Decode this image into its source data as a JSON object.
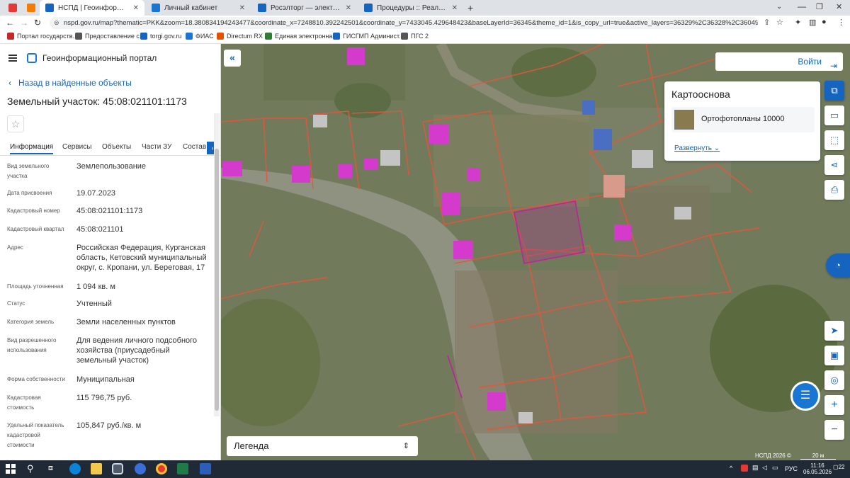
{
  "browser": {
    "tabs": [
      {
        "label": "",
        "color": "#e53935"
      },
      {
        "label": "",
        "color": "#f57c00"
      },
      {
        "label": "НСПД | Геоинформационный п",
        "color": "#1565c0",
        "active": true
      },
      {
        "label": "Личный кабинет",
        "color": "#1976d2"
      },
      {
        "label": "Росэлторг — электронная торго",
        "color": "#1565c0"
      },
      {
        "label": "Процедуры :: Реализация госи",
        "color": "#1565c0"
      }
    ],
    "new_tab": "+",
    "url": "nspd.gov.ru/map?thematic=PKK&zoom=18.380834194243477&coordinate_x=7248810.392242501&coordinate_y=7433045.429648423&baseLayerId=36345&theme_id=1&is_copy_url=true&active_layers=36329%2C36328%2C36049%2C37298%2C3729...",
    "bookmarks": [
      {
        "label": "Портал государств...",
        "color": "#c62828"
      },
      {
        "label": "Предоставление с...",
        "color": "#555"
      },
      {
        "label": "torgi.gov.ru",
        "color": "#1565c0"
      },
      {
        "label": "ФИАС",
        "color": "#1976d2"
      },
      {
        "label": "Directum RX",
        "color": "#e65100"
      },
      {
        "label": "Единая электронна...",
        "color": "#2e7d32"
      },
      {
        "label": "ГИСГМП Админист...",
        "color": "#1565c0"
      },
      {
        "label": "ПГС 2",
        "color": "#555"
      }
    ]
  },
  "header": {
    "portal_title": "Геоинформационный портал"
  },
  "panel": {
    "back_label": "Назад в найденные объекты",
    "title": "Земельный участок: 45:08:021101:1173",
    "tabs": [
      "Информация",
      "Сервисы",
      "Объекты",
      "Части ЗУ",
      "Состав"
    ],
    "rows": [
      {
        "label": "Вид земельного участка",
        "value": "Землепользование"
      },
      {
        "label": "Дата присвоения",
        "value": "19.07.2023"
      },
      {
        "label": "Кадастровый номер",
        "value": "45:08:021101:1173"
      },
      {
        "label": "Кадастровый квартал",
        "value": "45:08:021101"
      },
      {
        "label": "Адрес",
        "value": "Российская Федерация, Курганская область, Кетовский муниципальный округ, с. Кропани, ул. Береговая, 17"
      },
      {
        "label": "Площадь уточненная",
        "value": "1 094 кв. м"
      },
      {
        "label": "Статус",
        "value": "Учтенный"
      },
      {
        "label": "Категория земель",
        "value": "Земли населенных пунктов"
      },
      {
        "label": "Вид разрешенного использования",
        "value": "Для ведения личного подсобного хозяйства (приусадебный земельный участок)"
      },
      {
        "label": "Форма собственности",
        "value": "Муниципальная"
      },
      {
        "label": "Кадастровая стоимость",
        "value": "115 796,75 руб."
      },
      {
        "label": "Удельный показатель кадастровой стоимости",
        "value": "105,847 руб./кв. м"
      }
    ]
  },
  "map": {
    "login_label": "Войти",
    "basemap_title": "Картооснова",
    "basemap_item": "Ортофотопланы 10000",
    "expand_label": "Развернуть",
    "legend_label": "Легенда",
    "attribution": "НСПД 2026 ©",
    "scale_label": "20 м",
    "parcel_color": "#c0209a",
    "boundary_color": "#e8553a"
  },
  "taskbar": {
    "lang": "РУС",
    "time": "11:16",
    "date": "06.05.2026",
    "notif": "22"
  }
}
